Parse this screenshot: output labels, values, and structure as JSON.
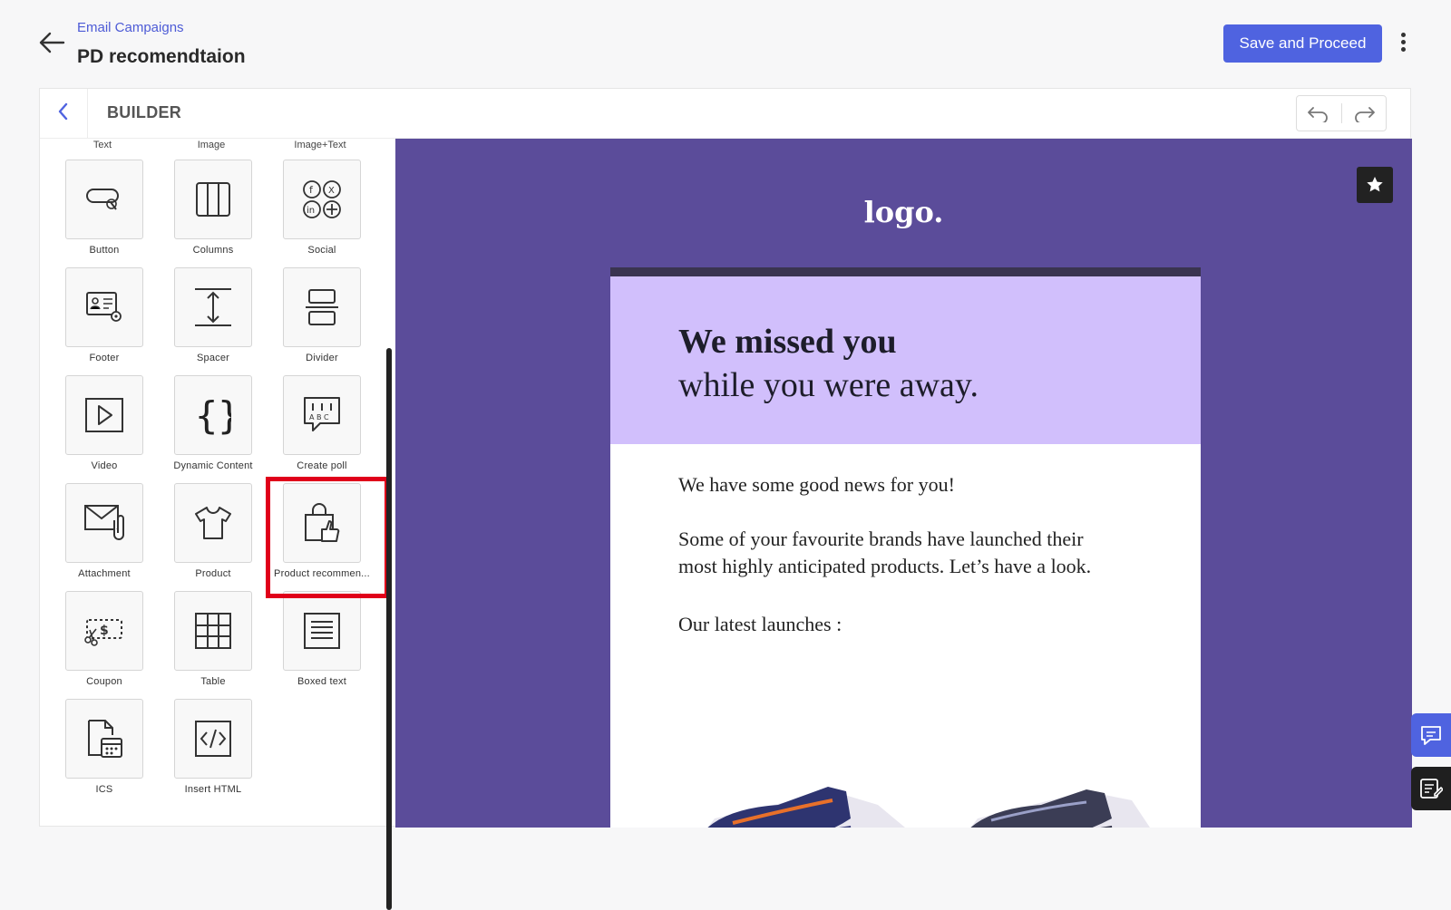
{
  "header": {
    "breadcrumb": "Email Campaigns",
    "title": "PD recomendtaion",
    "save_label": "Save and Proceed"
  },
  "builder": {
    "title": "BUILDER",
    "top_labels": [
      "Text",
      "Image",
      "Image+Text"
    ],
    "blocks": {
      "button": "Button",
      "columns": "Columns",
      "social": "Social",
      "footer": "Footer",
      "spacer": "Spacer",
      "divider": "Divider",
      "video": "Video",
      "dynamic": "Dynamic Content",
      "poll": "Create poll",
      "attachment": "Attachment",
      "product": "Product",
      "product_rec": "Product recommen...",
      "coupon": "Coupon",
      "table": "Table",
      "boxed": "Boxed text",
      "ics": "ICS",
      "html": "Insert HTML"
    }
  },
  "email": {
    "logo": "logo.",
    "headline": "We missed you",
    "subheadline": "while you were away.",
    "intro": "We have some good news for you!",
    "para1": "Some of your favourite brands have launched their",
    "para2": "most highly anticipated products. Let’s have a look.",
    "launches": "Our latest launches :"
  },
  "colors": {
    "accent": "#4f63e0",
    "canvas_bg": "#5b4c9a",
    "hero_bg": "#d1bffc",
    "highlight": "#e0001a"
  }
}
